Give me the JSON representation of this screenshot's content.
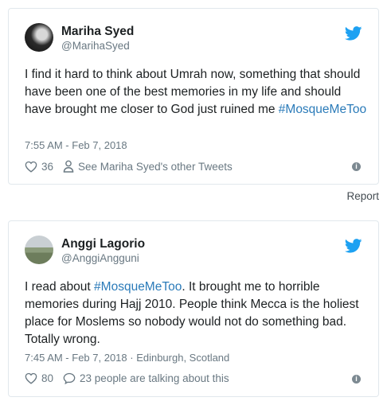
{
  "tweets": [
    {
      "display_name": "Mariha Syed",
      "handle": "@MarihaSyed",
      "text_before": "I find it hard to think about Umrah now, something that should have been one of the best memories in my life and should have brought me closer to God just ruined me ",
      "hashtag": "#MosqueMeToo",
      "text_after": "",
      "timestamp": "7:55 AM - Feb 7, 2018",
      "likes": "36",
      "secondary_action": "See Mariha Syed's other Tweets"
    },
    {
      "display_name": "Anggi Lagorio",
      "handle": "@AnggiAngguni",
      "text_before": "I read about ",
      "hashtag": "#MosqueMeToo",
      "text_after": ". It brought me to horrible memories during Hajj 2010. People think Mecca is the holiest place for Moslems so nobody would not do something bad. Totally wrong.",
      "timestamp": "7:45 AM - Feb 7, 2018 · Edinburgh, Scotland",
      "likes": "80",
      "secondary_action": "23 people are talking about this"
    }
  ],
  "report_label": "Report",
  "colors": {
    "link": "#2b7bb9",
    "twitter_blue": "#1da1f2",
    "muted": "#697882",
    "border": "#e1e8ed"
  }
}
